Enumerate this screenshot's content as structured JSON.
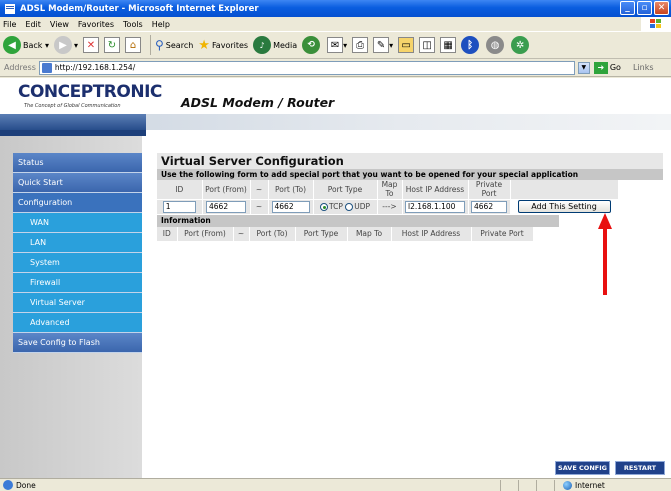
{
  "window": {
    "title": "ADSL Modem/Router - Microsoft Internet Explorer"
  },
  "menubar": [
    "File",
    "Edit",
    "View",
    "Favorites",
    "Tools",
    "Help"
  ],
  "toolbar": {
    "back": "Back",
    "search": "Search",
    "favorites": "Favorites",
    "media": "Media"
  },
  "addressbar": {
    "label": "Address",
    "url": "http://192.168.1.254/",
    "go": "Go",
    "links": "Links"
  },
  "header": {
    "brand": "CONCEPTRONIC",
    "tagline": "The Concept of Global Communication",
    "product": "ADSL Modem / Router"
  },
  "sidebar": {
    "items": [
      {
        "label": "Status",
        "type": "main"
      },
      {
        "label": "Quick Start",
        "type": "main"
      },
      {
        "label": "Configuration",
        "type": "main"
      },
      {
        "label": "WAN",
        "type": "sub"
      },
      {
        "label": "LAN",
        "type": "sub"
      },
      {
        "label": "System",
        "type": "sub"
      },
      {
        "label": "Firewall",
        "type": "sub"
      },
      {
        "label": "Virtual Server",
        "type": "sub"
      },
      {
        "label": "Advanced",
        "type": "sub"
      },
      {
        "label": "Save Config to Flash",
        "type": "main"
      }
    ]
  },
  "main": {
    "title": "Virtual Server Configuration",
    "description": "Use the following form to add special port that you want to be opened for your special application",
    "form_headers": {
      "id": "ID",
      "port_from": "Port (From)",
      "tilde": "~",
      "port_to": "Port (To)",
      "port_type": "Port Type",
      "map_to": "Map To",
      "host_ip": "Host IP Address",
      "private_port": "Private Port"
    },
    "form_values": {
      "id": "1",
      "port_from": "4662",
      "tilde": "~",
      "port_to": "4662",
      "tcp": "TCP",
      "udp": "UDP",
      "map_arrow": "--->",
      "host_ip": "l2.168.1.100",
      "private_port": "4662"
    },
    "add_button": "Add This Setting",
    "info_title": "Information",
    "info_headers": [
      "ID",
      "Port (From)",
      "~",
      "Port (To)",
      "Port Type",
      "Map To",
      "Host IP Address",
      "Private Port"
    ]
  },
  "footer_buttons": {
    "save": "SAVE CONFIG",
    "restart": "RESTART"
  },
  "statusbar": {
    "left": "Done",
    "zone": "Internet"
  },
  "colors": {
    "annotation_arrow": "#e81010",
    "nav_blue": "#2aa0dc",
    "title_blue": "#0a5ddf"
  }
}
